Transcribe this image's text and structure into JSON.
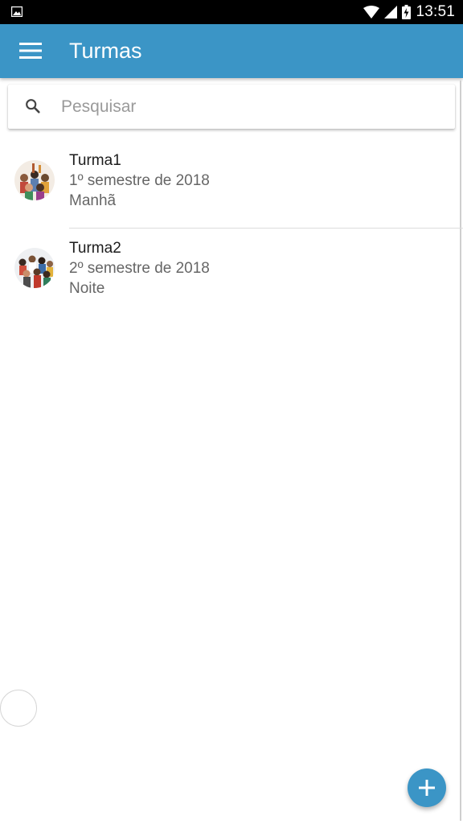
{
  "status_bar": {
    "time": "13:51",
    "icons": [
      "image-icon",
      "wifi-icon",
      "signal-icon",
      "battery-charging-icon"
    ]
  },
  "app_bar": {
    "title": "Turmas",
    "menu_icon": "hamburger-menu-icon"
  },
  "search": {
    "placeholder": "Pesquisar",
    "value": "",
    "icon": "search-icon"
  },
  "classes": [
    {
      "name": "Turma1",
      "semester": "1º semestre de 2018",
      "shift": "Manhã"
    },
    {
      "name": "Turma2",
      "semester": "2º semestre de 2018",
      "shift": "Noite"
    }
  ],
  "fab": {
    "icon": "plus-icon"
  },
  "colors": {
    "primary": "#3b95c6",
    "status_bar": "#000000",
    "background": "#ffffff"
  }
}
